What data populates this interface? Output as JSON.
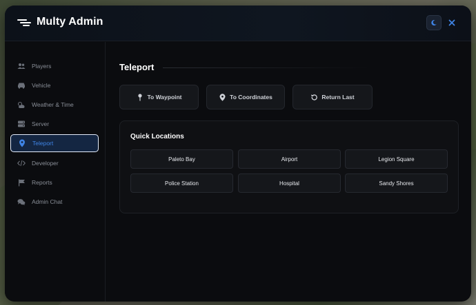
{
  "app": {
    "title": "Multy Admin"
  },
  "header": {
    "theme_icon": "moon-icon",
    "close_icon": "close-icon"
  },
  "sidebar": {
    "items": [
      {
        "label": "Players",
        "icon": "users-icon",
        "active": false
      },
      {
        "label": "Vehicle",
        "icon": "car-icon",
        "active": false
      },
      {
        "label": "Weather & Time",
        "icon": "cloud-sun-icon",
        "active": false
      },
      {
        "label": "Server",
        "icon": "server-icon",
        "active": false
      },
      {
        "label": "Teleport",
        "icon": "location-pin-icon",
        "active": true
      },
      {
        "label": "Developer",
        "icon": "code-icon",
        "active": false
      },
      {
        "label": "Reports",
        "icon": "flag-icon",
        "active": false
      },
      {
        "label": "Admin Chat",
        "icon": "chat-icon",
        "active": false
      }
    ]
  },
  "main": {
    "title": "Teleport",
    "actions": [
      {
        "label": "To Waypoint",
        "icon": "map-pin-icon"
      },
      {
        "label": "To Coordinates",
        "icon": "location-marker-icon"
      },
      {
        "label": "Return Last",
        "icon": "undo-icon"
      }
    ],
    "quick_locations": {
      "title": "Quick Locations",
      "items": [
        "Paleto Bay",
        "Airport",
        "Legion Square",
        "Police Station",
        "Hospital",
        "Sandy Shores"
      ]
    }
  },
  "colors": {
    "accent": "#3f84e5",
    "background": "#0b0c0f"
  }
}
